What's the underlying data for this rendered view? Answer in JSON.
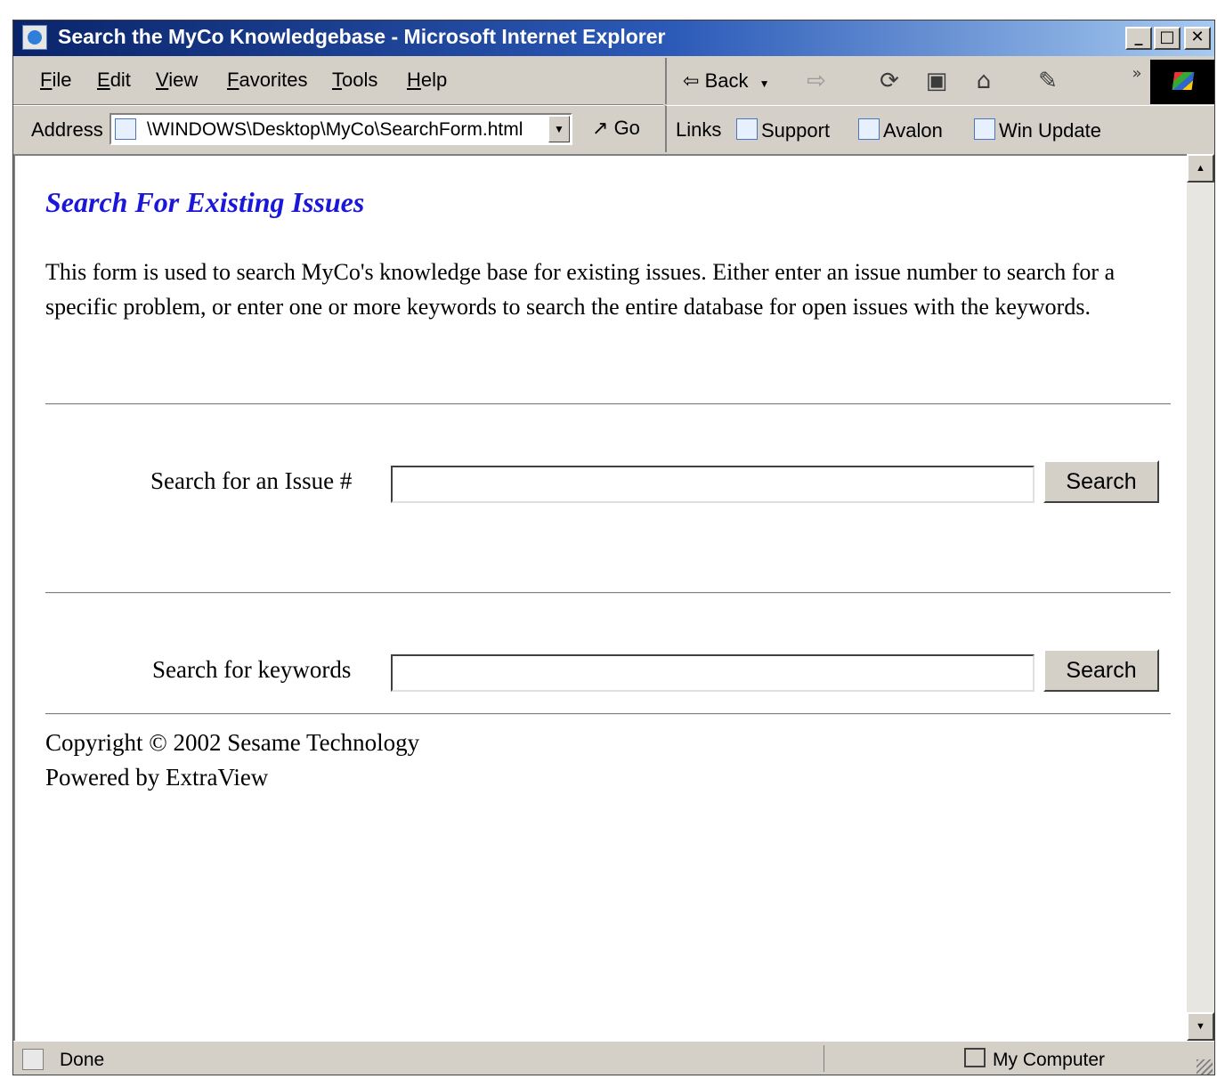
{
  "window": {
    "title": "Search the MyCo Knowledgebase - Microsoft Internet Explorer",
    "controls": {
      "minimize": "_",
      "maximize": "□",
      "close": "✕"
    }
  },
  "menu": [
    "File",
    "Edit",
    "View",
    "Favorites",
    "Tools",
    "Help"
  ],
  "nav": {
    "back_label": "Back",
    "icons": [
      "back-icon",
      "forward-icon",
      "refresh-icon",
      "stop-icon",
      "home-icon",
      "edit-icon"
    ],
    "overflow": "»"
  },
  "address": {
    "label": "Address",
    "value": "\\WINDOWS\\Desktop\\MyCo\\SearchForm.html",
    "go_label": "Go"
  },
  "links": {
    "label": "Links",
    "items": [
      "Support",
      "Avalon",
      "Win Update"
    ]
  },
  "page": {
    "heading": "Search For Existing Issues",
    "description": "This form is used to search MyCo's knowledge base for existing issues. Either enter an issue number to search for a specific problem, or enter one or more keywords to search the entire database for open issues with the keywords.",
    "issue_search": {
      "label": "Search for an Issue #",
      "value": "",
      "button": "Search"
    },
    "keyword_search": {
      "label": "Search for keywords",
      "value": "",
      "button": "Search"
    },
    "footer": {
      "copyright": "Copyright © 2002 Sesame Technology",
      "powered": "Powered by ExtraView"
    }
  },
  "status": {
    "text": "Done",
    "zone": "My Computer"
  },
  "colors": {
    "titlebar_start": "#0a246a",
    "titlebar_end": "#a6caf0",
    "heading": "#1b17d8",
    "chrome": "#d4d0c8"
  }
}
